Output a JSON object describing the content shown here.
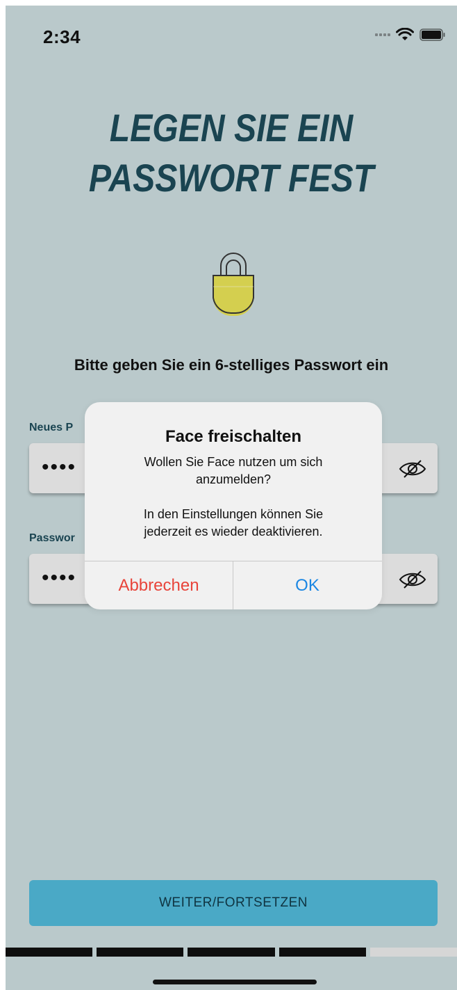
{
  "status_bar": {
    "time": "2:34"
  },
  "title": {
    "line1": "LEGEN SIE EIN",
    "line2": "PASSWORT FEST"
  },
  "instruction": "Bitte geben Sie ein 6-stelliges Passwort ein",
  "fields": [
    {
      "label": "Neues P",
      "value_masked": "••••"
    },
    {
      "label": "Passwor",
      "value_masked": "••••"
    }
  ],
  "alert": {
    "title": "Face freischalten",
    "message_line1": "Wollen Sie Face nutzen um sich",
    "message_line2": "anzumelden?",
    "message_line3": "In den Einstellungen können Sie",
    "message_line4": "jederzeit es wieder deaktivieren.",
    "cancel_label": "Abbrechen",
    "ok_label": "OK"
  },
  "continue_button": "WEITER/FORTSETZEN",
  "progress": {
    "completed_steps": 4,
    "total_steps": 5
  },
  "colors": {
    "background": "#bac9cb",
    "title": "#1a4451",
    "primary_button": "#4aa9c6",
    "cancel": "#e8443a",
    "ok": "#1a86e3",
    "lock_fill": "#d4cf4f"
  },
  "icons": [
    "lock-icon",
    "eye-slash-icon",
    "wifi-icon",
    "battery-icon"
  ]
}
